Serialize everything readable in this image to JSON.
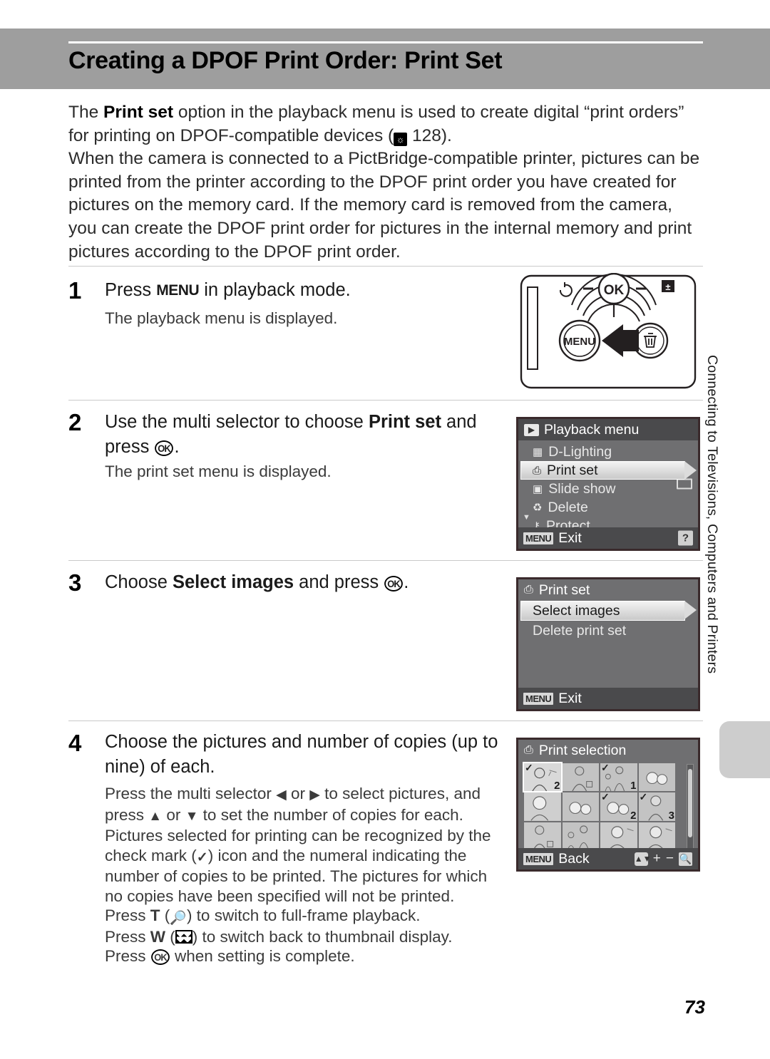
{
  "header": {
    "title": "Creating a DPOF Print Order: Print Set",
    "band_color": "#9e9e9e"
  },
  "intro": {
    "para1_a": "The ",
    "para1_b": "Print set",
    "para1_c": " option in the playback menu is used to create digital “print orders” for printing on DPOF-compatible devices (",
    "para1_ref_icon": "book-icon",
    "para1_ref_page": "128",
    "para1_d": ").",
    "para2": "When the camera is connected to a PictBridge-compatible printer, pictures can be printed from the printer according to the DPOF print order you have created for pictures on the memory card. If the memory card is removed from the camera, you can create the DPOF print order for pictures in the internal memory and print pictures according to the DPOF print order."
  },
  "steps": [
    {
      "number": "1",
      "head_a": "Press ",
      "head_glyph": "MENU",
      "head_b": " in playback mode.",
      "body": "The playback menu is displayed."
    },
    {
      "number": "2",
      "head_a": "Use the multi selector to choose ",
      "head_bold": "Print set",
      "head_b": " and press ",
      "head_glyph": "OK",
      "head_c": ".",
      "body": "The print set menu is displayed."
    },
    {
      "number": "3",
      "head_a": "Choose ",
      "head_bold": "Select images",
      "head_b": " and press ",
      "head_glyph": "OK",
      "head_c": "."
    },
    {
      "number": "4",
      "head_a": "Choose the pictures and number of copies (up to nine) of each.",
      "body_lines": [
        "Press the multi selector ◀ or ▶ to select pictures, and press ▲ or ▼ to set the number of copies for each. Pictures selected for printing can be recognized by the check mark (✓) icon and the numeral indicating the number of copies to be printed. The pictures for which no copies have been specified will not be printed.",
        "Press T (zoom-in-icon) to switch to full-frame playback.",
        "Press W (thumbnail-icon) to switch back to thumbnail display.",
        "Press OK when setting is complete."
      ],
      "body_l1": "Press the multi selector ",
      "body_l1b": " or ",
      "body_l1c": " to select pictures, and",
      "body_l2a": "press ",
      "body_l2b": " or ",
      "body_l2c": " to set the number of copies for each.",
      "body_l3": "Pictures selected for printing can be recognized by the",
      "body_l4a": "check mark (",
      "body_l4b": ") icon and the numeral indicating the",
      "body_l5": "number of copies to be printed. The pictures for which",
      "body_l6": "no copies have been specified will not be printed.",
      "body_l7a": "Press ",
      "body_l7b": "T",
      "body_l7c": " (",
      "body_l7d": ") to switch to full-frame playback.",
      "body_l8a": "Press ",
      "body_l8b": "W",
      "body_l8c": " (",
      "body_l8d": ") to switch back to thumbnail display.",
      "body_l9a": "Press ",
      "body_l9b": " when setting is complete."
    }
  ],
  "camera_figure": {
    "name": "camera-rear-illustration",
    "menu_button_label": "MENU",
    "ok_button_label": "OK",
    "delete_icon": "trash-icon",
    "selftimer_icon": "self-timer-icon",
    "exposure_icon": "exposure-compensation-icon",
    "arrow_icon": "pointer-arrow-icon"
  },
  "lcd_playback_menu": {
    "title": "Playback menu",
    "title_icon": "playback-icon",
    "rows": [
      {
        "label": "D-Lighting",
        "icon": "d-lighting-icon",
        "selected": false
      },
      {
        "label": "Print set",
        "icon": "printer-icon",
        "selected": true
      },
      {
        "label": "Slide show",
        "icon": "slideshow-icon",
        "selected": false
      },
      {
        "label": "Delete",
        "icon": "trash-icon",
        "selected": false
      },
      {
        "label": "Protect",
        "icon": "key-icon",
        "selected": false
      }
    ],
    "footer_chip": "MENU",
    "footer_label": "Exit",
    "help_badge": "?"
  },
  "lcd_print_set": {
    "title": "Print set",
    "title_icon": "printer-icon",
    "rows": [
      {
        "label": "Select images",
        "selected": true
      },
      {
        "label": "Delete print set",
        "selected": false
      }
    ],
    "footer_chip": "MENU",
    "footer_label": "Exit"
  },
  "lcd_print_selection": {
    "title": "Print selection",
    "title_icon": "printer-icon",
    "footer_chip": "MENU",
    "footer_label": "Back",
    "footer_icons": [
      "up-down-icon",
      "plus-icon",
      "minus-icon",
      "magnifier-icon"
    ],
    "thumbnails": [
      {
        "count": "2",
        "checked": true,
        "active": true
      },
      {
        "count": "",
        "checked": false,
        "active": false
      },
      {
        "count": "1",
        "checked": true,
        "active": false
      },
      {
        "count": "",
        "checked": false,
        "active": false
      },
      {
        "count": "",
        "checked": false,
        "active": false
      },
      {
        "count": "",
        "checked": false,
        "active": false
      },
      {
        "count": "2",
        "checked": true,
        "active": false
      },
      {
        "count": "3",
        "checked": true,
        "active": false
      },
      {
        "count": "",
        "checked": false,
        "active": false
      },
      {
        "count": "",
        "checked": false,
        "active": false
      },
      {
        "count": "",
        "checked": false,
        "active": false
      },
      {
        "count": "",
        "checked": false,
        "active": false
      }
    ]
  },
  "side_tab": {
    "chapter": "Connecting to Televisions, Computers and Printers",
    "mark_color": "#cdcdcd"
  },
  "page_number": "73"
}
